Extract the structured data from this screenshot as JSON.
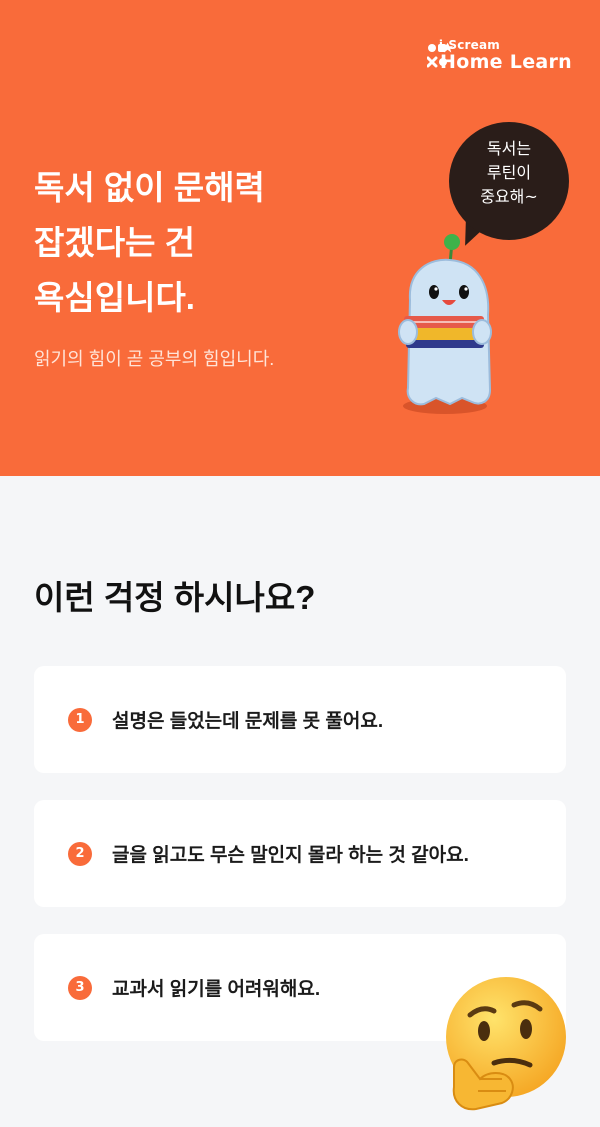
{
  "colors": {
    "hero_bg": "#f96b3a",
    "accent": "#f96b3a",
    "page_bg": "#f5f6f8",
    "card_bg": "#ffffff",
    "bubble_bg": "#2a1d19"
  },
  "logo": {
    "brand_small": "i-Scream",
    "brand_main": "Home Learn",
    "icon": "i-scream-logo-icon"
  },
  "hero": {
    "title_lines": [
      "독서 없이 문해력",
      "잡겠다는 건",
      "욕심입니다."
    ],
    "subtitle": "읽기의 힘이 곧 공부의 힘입니다.",
    "bubble_lines": [
      "독서는",
      "루틴이",
      "중요해~"
    ],
    "mascot_icon": "mascot-holding-books-icon"
  },
  "worries": {
    "title": "이런 걱정 하시나요?",
    "items": [
      {
        "num": "1",
        "text": "설명은 들었는데 문제를 못 풀어요."
      },
      {
        "num": "2",
        "text": "글을 읽고도 무슨 말인지 몰라 하는 것 같아요."
      },
      {
        "num": "3",
        "text": "교과서 읽기를 어려워해요."
      }
    ],
    "emoji_icon": "thinking-face-icon"
  }
}
